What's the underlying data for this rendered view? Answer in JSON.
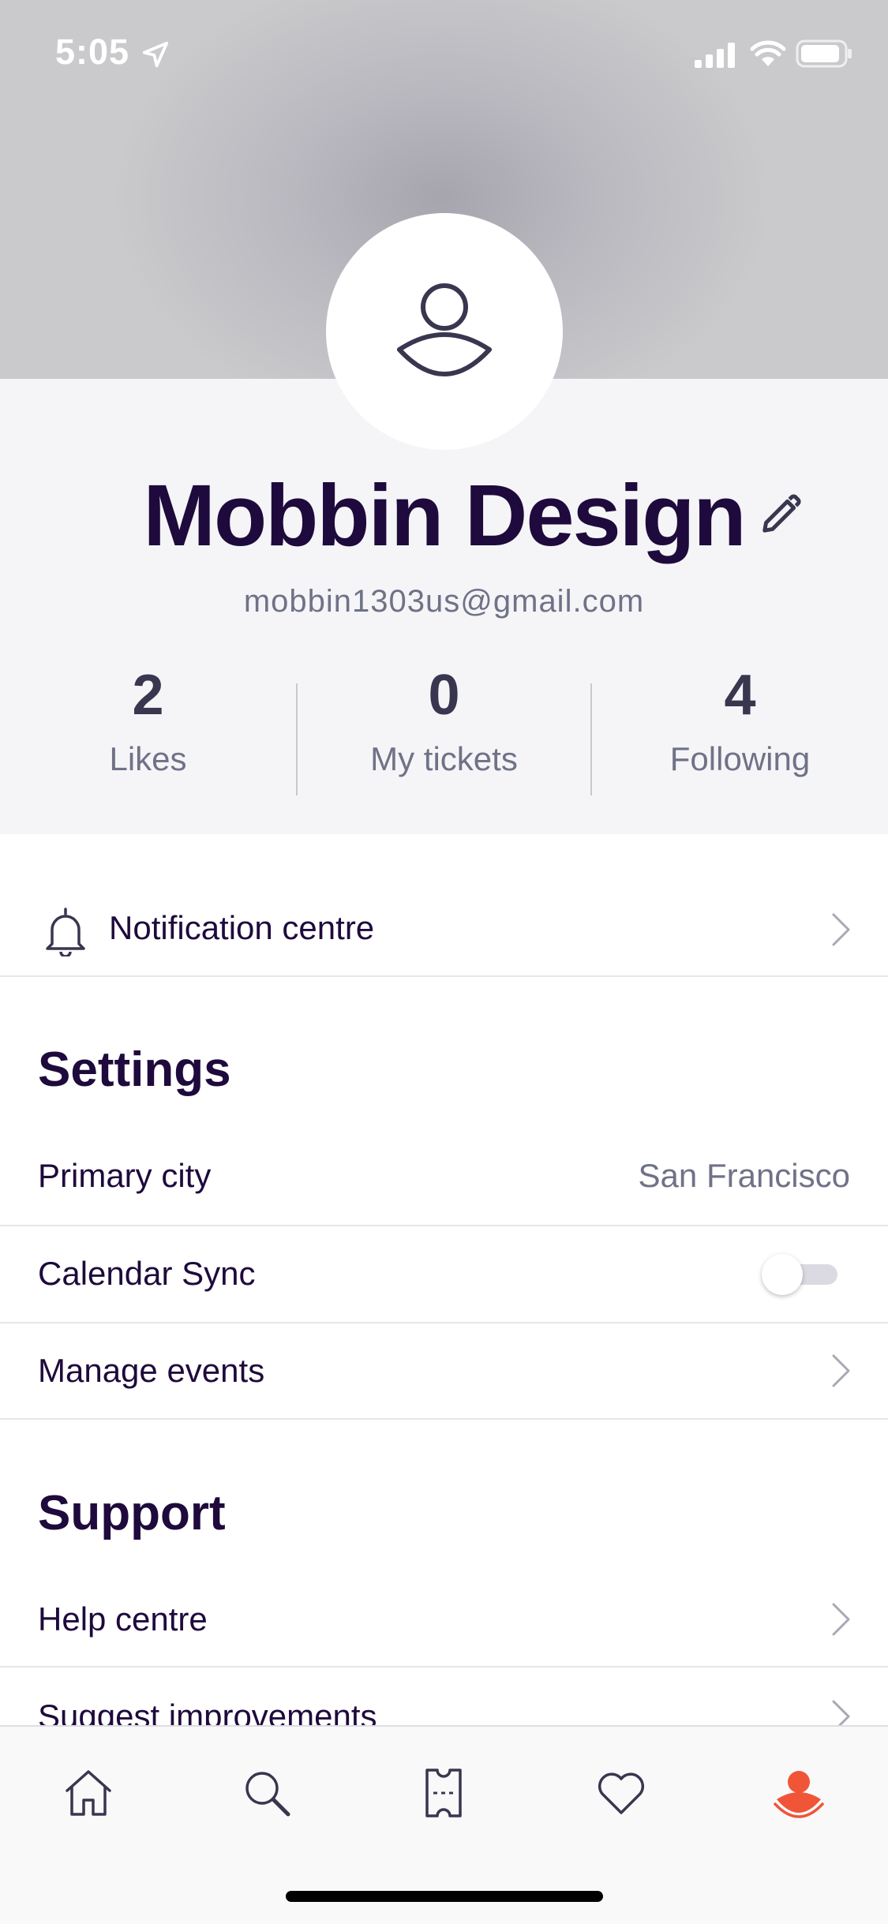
{
  "status_bar": {
    "time": "5:05"
  },
  "profile": {
    "name": "Mobbin Design",
    "email": "mobbin1303us@gmail.com",
    "stats": [
      {
        "value": "2",
        "label": "Likes"
      },
      {
        "value": "0",
        "label": "My tickets"
      },
      {
        "value": "4",
        "label": "Following"
      }
    ]
  },
  "notifications": {
    "label": "Notification centre"
  },
  "settings": {
    "title": "Settings",
    "primary_city_label": "Primary city",
    "primary_city_value": "San Francisco",
    "calendar_sync_label": "Calendar Sync",
    "calendar_sync_on": false,
    "manage_events_label": "Manage events"
  },
  "support": {
    "title": "Support",
    "help_label": "Help centre",
    "suggest_label": "Suggest improvements"
  },
  "tab_bar": {
    "tabs": [
      "home-icon",
      "search-icon",
      "ticket-icon",
      "heart-icon",
      "profile-icon"
    ],
    "active_color": "#f05537",
    "inactive_color": "#39364f"
  }
}
